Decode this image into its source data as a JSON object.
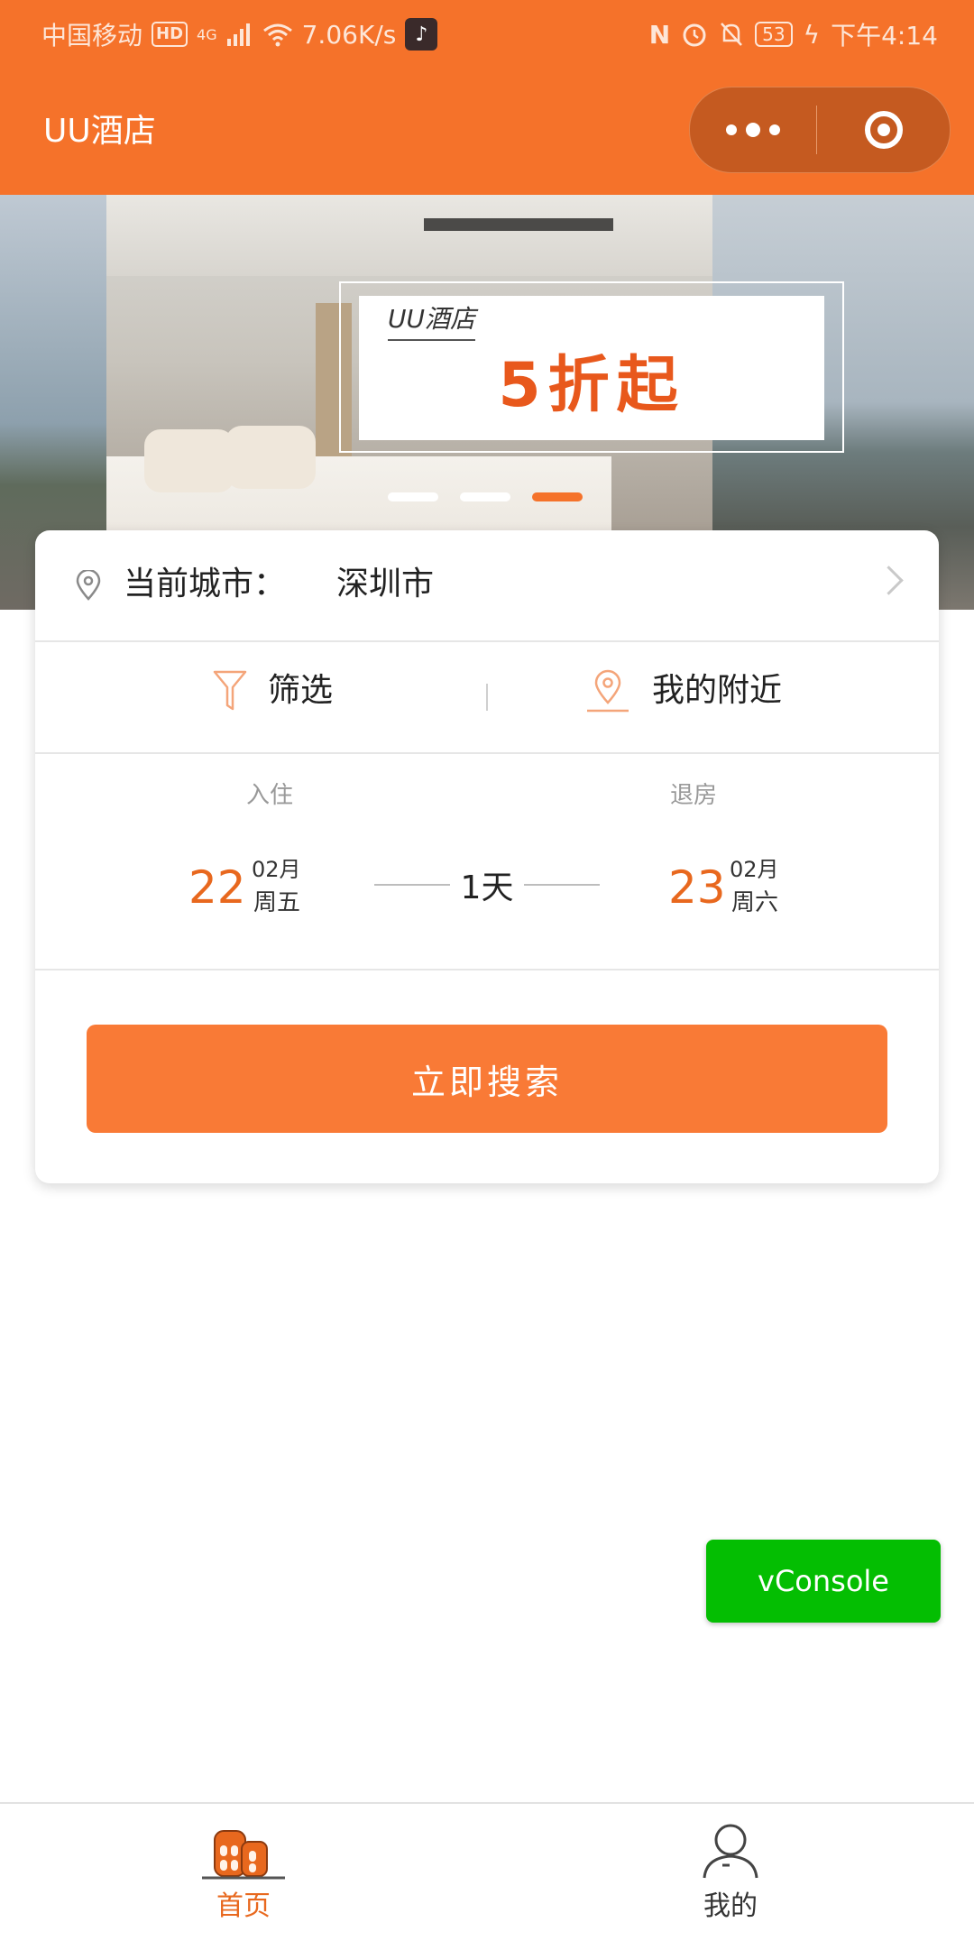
{
  "status_bar": {
    "carrier": "中国移动",
    "hd": "HD",
    "network": "4G",
    "speed": "7.06K/s",
    "battery": "53",
    "time": "下午4:14"
  },
  "navbar": {
    "title": "UU酒店"
  },
  "banner": {
    "brand": "UU酒店",
    "headline": "5折起",
    "active_slide": 3,
    "total_slides": 3
  },
  "search_card": {
    "city_label": "当前城市：",
    "city_value": "深圳市",
    "filter_label": "筛选",
    "nearby_label": "我的附近",
    "checkin": {
      "label": "入住",
      "day": "22",
      "month": "02月",
      "weekday": "周五"
    },
    "checkout": {
      "label": "退房",
      "day": "23",
      "month": "02月",
      "weekday": "周六"
    },
    "nights": "1天",
    "search_button": "立即搜索"
  },
  "vconsole": {
    "label": "vConsole"
  },
  "tabbar": {
    "items": [
      {
        "label": "首页",
        "active": true
      },
      {
        "label": "我的",
        "active": false
      }
    ]
  },
  "colors": {
    "brand": "#f5722a",
    "button": "#f97a36",
    "date_accent": "#e8681e",
    "vconsole": "#04be02"
  }
}
